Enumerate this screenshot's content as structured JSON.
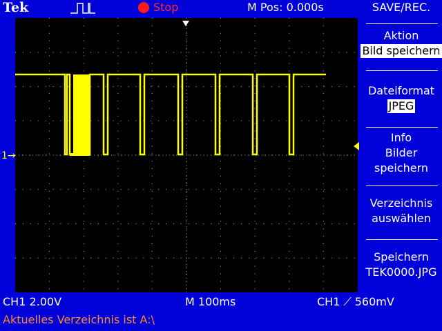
{
  "header": {
    "brand": "Tek",
    "trigger_icon": "pulse-trigger-icon",
    "run_state": "Stop",
    "run_state_color": "#ff1a1a",
    "position": "M Pos: 0.000s",
    "panel_title": "SAVE/REC."
  },
  "menu": {
    "items": [
      {
        "label": "Aktion",
        "value": "Bild speichern"
      },
      {
        "label": "Dateiformat",
        "value": "JPEG"
      },
      {
        "label_lines": [
          "Info",
          "Bilder",
          "speichern"
        ]
      },
      {
        "label_lines": [
          "Verzeichnis",
          "auswählen"
        ]
      },
      {
        "label_lines": [
          "Speichern",
          "TEK0000.JPG"
        ]
      }
    ]
  },
  "scope": {
    "channel_marker": "1",
    "trace_color": "#ffff00",
    "grid_color": "#b0b0b0",
    "background": "#000000",
    "signal": "pulse-train"
  },
  "status": {
    "ch1_scale": "CH1  2.00V",
    "time_base": "M 100ms",
    "trigger": "CH1 ⟋ 560mV",
    "message": "Aktuelles Verzeichnis ist A:\\",
    "message_color": "#ff8a2a"
  },
  "colors": {
    "panel_blue": "#0000d8",
    "text": "#ffffff"
  }
}
